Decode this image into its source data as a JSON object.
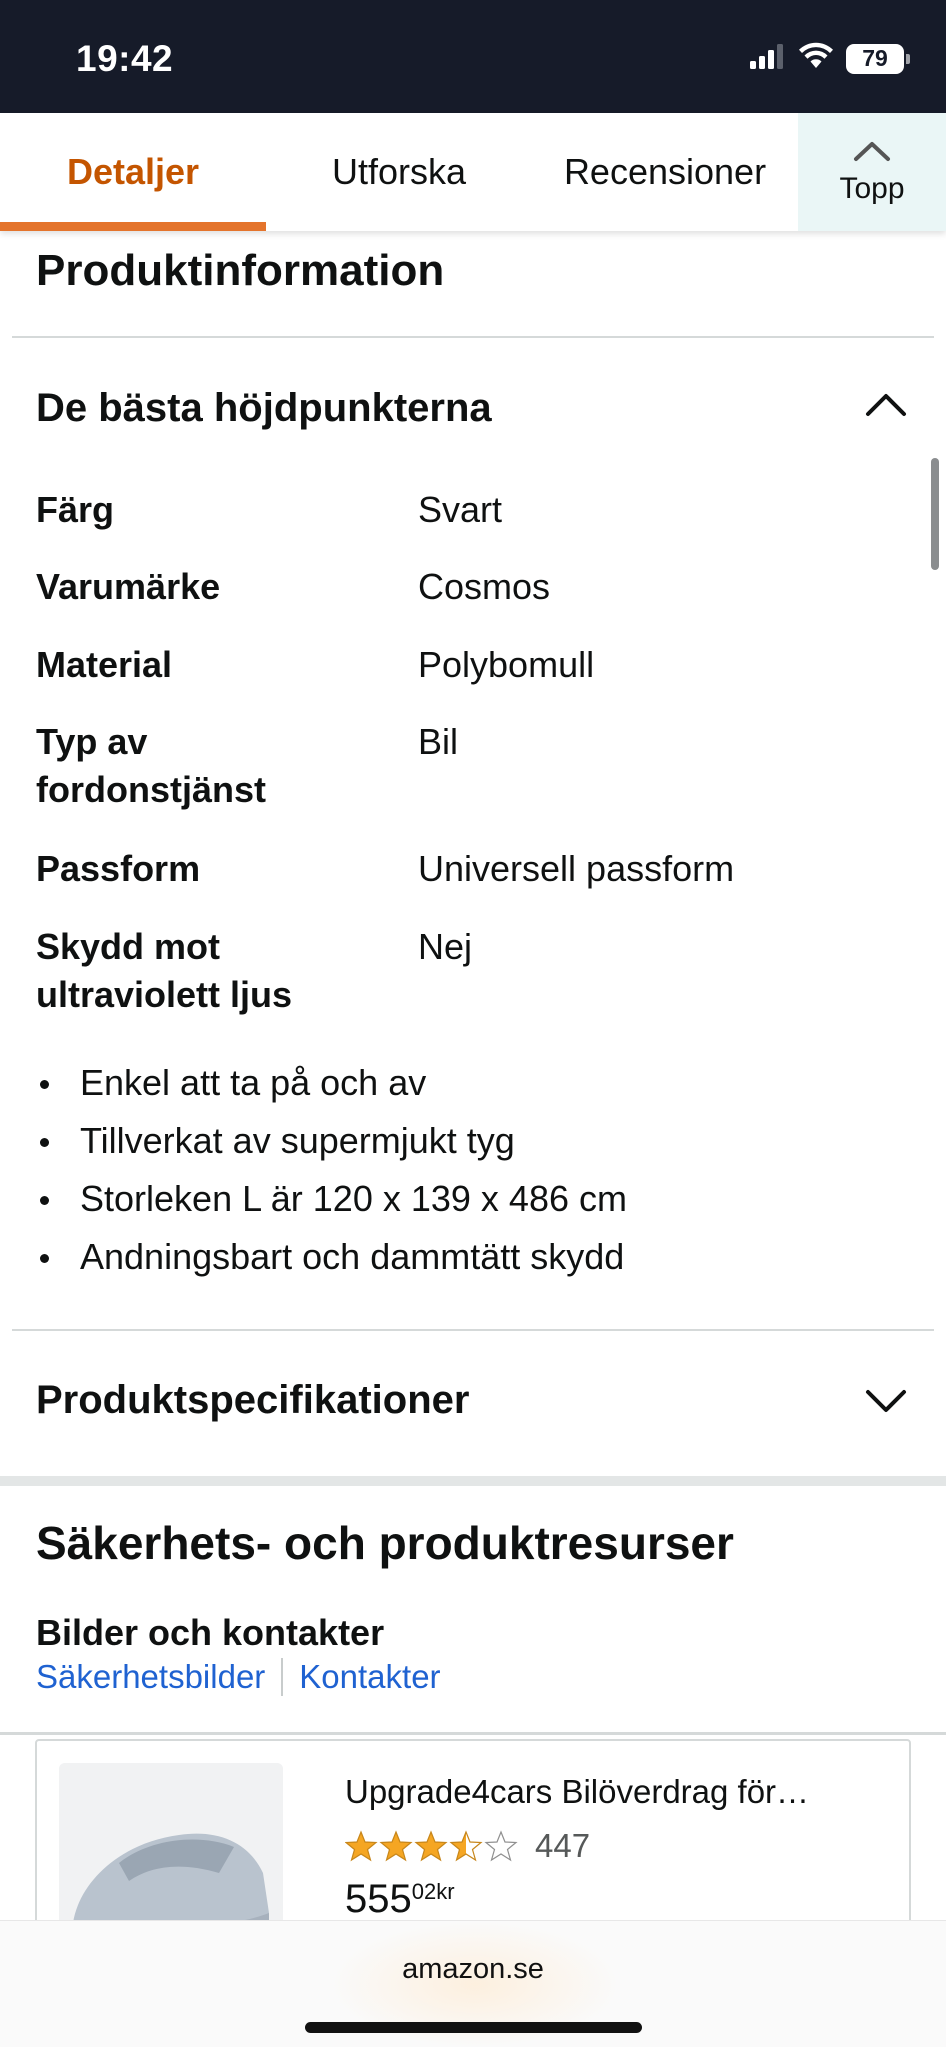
{
  "status_bar": {
    "time": "19:42",
    "battery": "79"
  },
  "tabs": {
    "details": "Detaljer",
    "explore": "Utforska",
    "reviews": "Recensioner",
    "top": "Topp"
  },
  "product_information": {
    "title": "Produktinformation",
    "highlights": {
      "title": "De bästa höjdpunkterna",
      "expanded": true,
      "rows": [
        {
          "key": "Färg",
          "value": "Svart"
        },
        {
          "key": "Varumärke",
          "value": "Cosmos"
        },
        {
          "key": "Material",
          "value": "Polybomull"
        },
        {
          "key": "Typ av fordonstjänst",
          "value": "Bil"
        },
        {
          "key": "Passform",
          "value": "Universell passform"
        },
        {
          "key": "Skydd mot ultraviolett ljus",
          "value": "Nej"
        }
      ],
      "bullets": [
        "Enkel att ta på och av",
        "Tillverkat av supermjukt tyg",
        "Storleken L är 120 x 139 x 486 cm",
        "Andningsbart och dammtätt skydd"
      ]
    },
    "specifications": {
      "title": "Produktspecifikationer",
      "expanded": false
    }
  },
  "safety_resources": {
    "title": "Säkerhets- och produktresurser",
    "subtitle": "Bilder och kontakter",
    "links": {
      "images": "Säkerhetsbilder",
      "contacts": "Kontakter"
    }
  },
  "product_card": {
    "title": "Upgrade4cars Bilöverdrag för…",
    "rating": 3.5,
    "rating_count": "447",
    "price_whole": "555",
    "price_fraction": "02",
    "price_currency": "kr"
  },
  "bottom_bar": {
    "url": "amazon.se"
  },
  "colors": {
    "accent": "#e4742c",
    "link": "#1f62d1",
    "star": "#f5a623",
    "status_bar": "#161b29"
  }
}
